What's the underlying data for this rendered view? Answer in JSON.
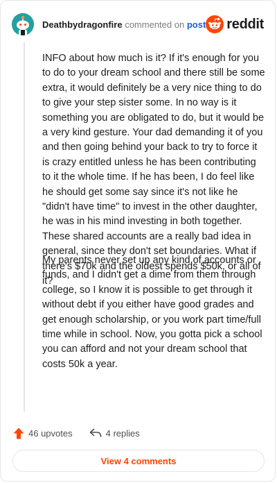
{
  "header": {
    "username": "Deathbydragonfire",
    "commented_on_text": "commented on",
    "post_link_text": "post",
    "logo_text": "reddit"
  },
  "comment": {
    "paragraphs": [
      "INFO about how much is it? If it's enough for you to do to your dream school and there still be some extra, it would definitely be a very nice thing to do to give your step sister some. In no way is it something you are obligated to do, but it would be a very kind gesture. Your dad demanding it of you and then going behind your back to try to force it is crazy entitled unless he has been contributing to it the whole time. If he has been, I do feel like he should get some say since it's not like he \"didn't have time\" to invest in the other daughter, he was in his mind investing in both together. These shared accounts are a really bad idea in general, since they don't set boundaries. What if there's $70k and the oldest spends $50k, or all of it?",
      "My parents never set up any kind of accounts or funds, and I didn't get a dime from them through college, so I know it is possible to get through it without debt if you either have good grades and get enough scholarship, or you work part time/full time while in school. Now, you gotta pick a school you can afford and not your dream school that costs 50k a year."
    ]
  },
  "actions": {
    "upvotes_label": "46 upvotes",
    "replies_label": "4 replies",
    "view_comments_label": "View 4 comments"
  },
  "colors": {
    "accent": "#ff4500",
    "link": "#1a5fd6",
    "avatar_bg": "#24a0a0",
    "thread_line": "#e3e5e7"
  },
  "icons": [
    "avatar-snoo",
    "reddit-logo-icon",
    "upvote-arrow-icon",
    "reply-arrow-icon"
  ]
}
